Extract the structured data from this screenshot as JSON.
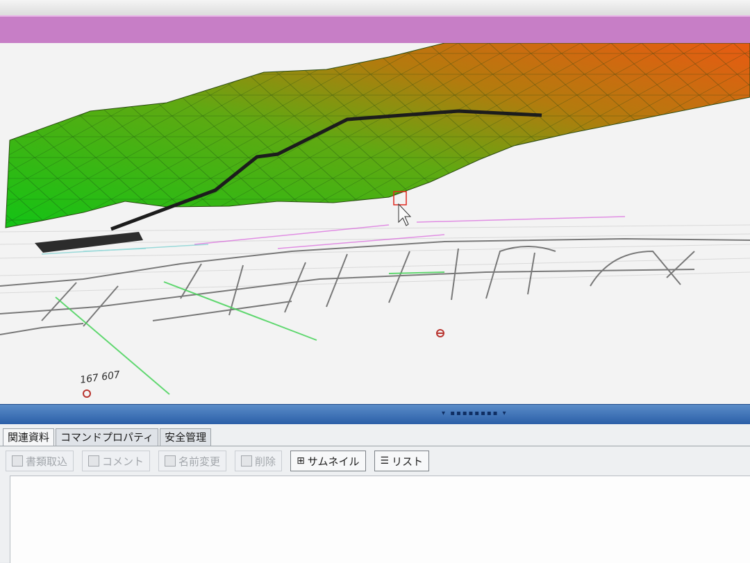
{
  "tabs": [
    {
      "label": "関連資料",
      "active": true
    },
    {
      "label": "コマンドプロパティ",
      "active": false
    },
    {
      "label": "安全管理",
      "active": false
    }
  ],
  "toolbar": {
    "import_label": "書類取込",
    "comment_label": "コメント",
    "rename_label": "名前変更",
    "delete_label": "削除",
    "thumbnail_label": "サムネイル",
    "list_label": "リスト"
  },
  "viewport": {
    "coordinate_label": "167 607",
    "surface_gradient": [
      "#19c41b",
      "#e1660e"
    ],
    "route_color": "#1c1c1c"
  },
  "accent": {
    "titlebar": "#c77ec6",
    "splitter": "#2b5fa8"
  }
}
